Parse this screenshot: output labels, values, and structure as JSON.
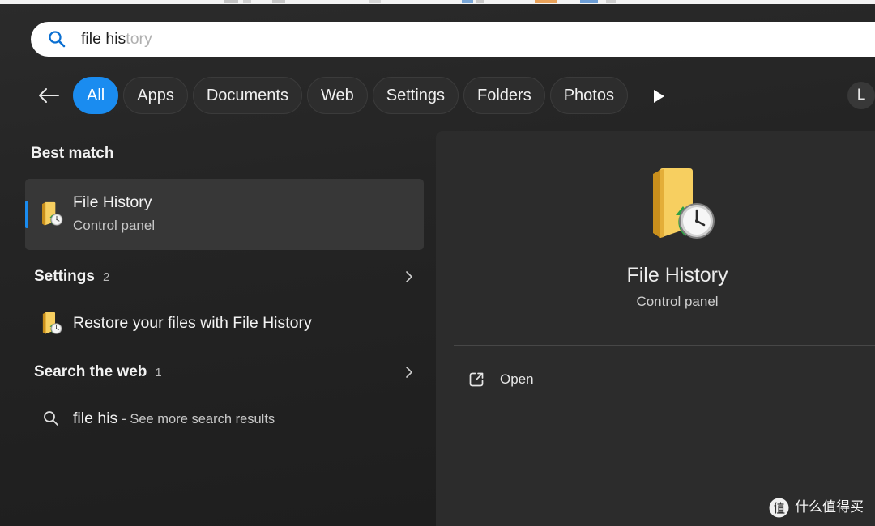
{
  "theme": {
    "accent": "#1a8cf0",
    "search_icon": "#0a6fd1",
    "folder": "#f7cf60"
  },
  "search": {
    "icon": "search-icon",
    "query": "file his",
    "suggestion": "tory"
  },
  "filters": {
    "back_icon": "back-arrow-icon",
    "chips": [
      {
        "label": "All",
        "active": true
      },
      {
        "label": "Apps",
        "active": false
      },
      {
        "label": "Documents",
        "active": false
      },
      {
        "label": "Web",
        "active": false
      },
      {
        "label": "Settings",
        "active": false
      },
      {
        "label": "Folders",
        "active": false
      },
      {
        "label": "Photos",
        "active": false
      }
    ],
    "more_icon": "play-icon",
    "avatar_initial": "L"
  },
  "results": {
    "best_match": {
      "heading": "Best match",
      "item": {
        "title": "File History",
        "subtitle": "Control panel",
        "icon": "file-history-icon",
        "selected": true
      }
    },
    "settings": {
      "heading": "Settings",
      "count": "2",
      "expand_icon": "chevron-right-icon",
      "items": [
        {
          "title": "Restore your files with File History",
          "icon": "file-history-icon"
        }
      ]
    },
    "web": {
      "heading": "Search the web",
      "count": "1",
      "expand_icon": "chevron-right-icon",
      "items": [
        {
          "query": "file his",
          "suffix": "- See more search results",
          "icon": "search-icon"
        }
      ]
    }
  },
  "preview": {
    "icon": "file-history-icon",
    "title": "File History",
    "subtitle": "Control panel",
    "actions": [
      {
        "label": "Open",
        "icon": "open-external-icon"
      }
    ]
  },
  "watermark": {
    "logo_glyph": "值",
    "text": "什么值得买"
  }
}
